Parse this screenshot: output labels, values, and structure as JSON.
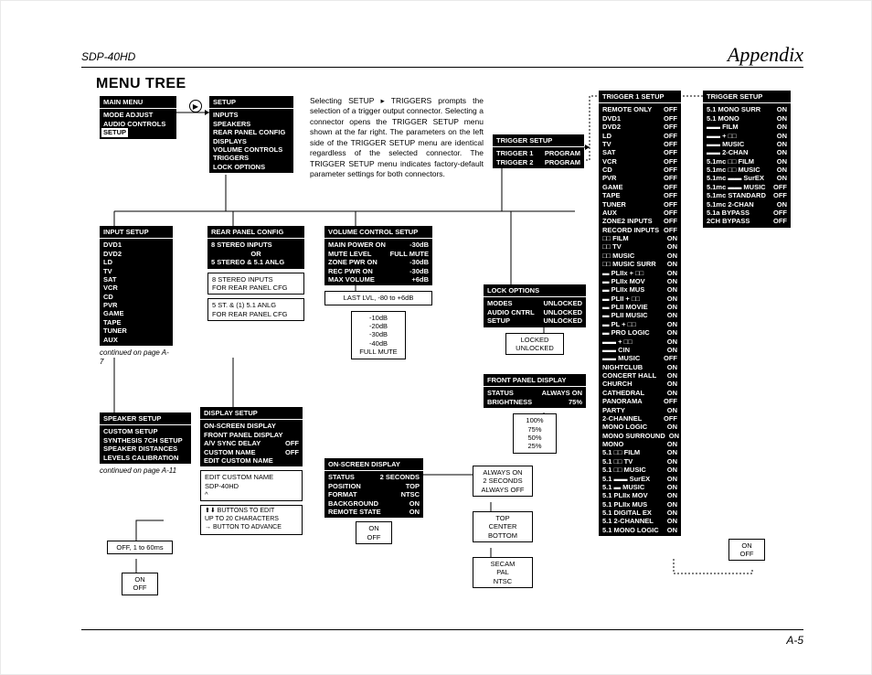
{
  "header": {
    "model": "SDP-40HD",
    "section": "Appendix",
    "page_no": "A-5"
  },
  "title": "MENU TREE",
  "body_text": "Selecting SETUP ▸ TRIGGERS prompts the selection of a trigger output connector. Selecting a connector opens the TRIGGER SETUP menu shown at the far right. The parameters on the left side of the TRIGGER SETUP menu are identical regardless of the selected connector. The TRIGGER SETUP menu indicates factory-default parameter settings for both connectors.",
  "main_menu": {
    "title": "MAIN MENU",
    "items": [
      "MODE ADJUST",
      "AUDIO CONTROLS",
      "SETUP"
    ]
  },
  "setup": {
    "title": "SETUP",
    "items": [
      "INPUTS",
      "SPEAKERS",
      "REAR PANEL CONFIG",
      "DISPLAYS",
      "VOLUME CONTROLS",
      "TRIGGERS",
      "LOCK OPTIONS"
    ]
  },
  "input_setup": {
    "title": "INPUT SETUP",
    "items": [
      "DVD1",
      "DVD2",
      "LD",
      "TV",
      "SAT",
      "VCR",
      "CD",
      "PVR",
      "GAME",
      "TAPE",
      "TUNER",
      "AUX"
    ],
    "continued": "continued on page A-7"
  },
  "speaker_setup": {
    "title": "SPEAKER SETUP",
    "items": [
      "CUSTOM SETUP",
      "SYNTHESIS 7CH SETUP",
      "SPEAKER DISTANCES",
      "LEVELS CALIBRATION"
    ],
    "continued": "continued on page A-11"
  },
  "avsync_opts": {
    "a": "OFF, 1 to 60ms",
    "b": [
      "ON",
      "OFF"
    ]
  },
  "rear_panel": {
    "title": "REAR PANEL CONFIG",
    "items": [
      "8 STEREO INPUTS",
      "OR",
      "5 STEREO & 5.1 ANLG"
    ],
    "sub1": "8 STEREO INPUTS\nFOR REAR PANEL CFG",
    "sub2": "5 ST. & (1) 5.1 ANLG\nFOR REAR PANEL CFG"
  },
  "display_setup": {
    "title": "DISPLAY SETUP",
    "rows": [
      [
        "ON-SCREEN DISPLAY",
        ""
      ],
      [
        "FRONT PANEL DISPLAY",
        ""
      ],
      [
        "A/V SYNC DELAY",
        "OFF"
      ],
      [
        "CUSTOM NAME",
        "OFF"
      ],
      [
        "EDIT CUSTOM NAME",
        ""
      ]
    ],
    "edit_box": "EDIT CUSTOM NAME\nSDP-40HD\n^",
    "hint": "⬆⬇ BUTTONS TO EDIT\nUP TO 20 CHARACTERS\n→ BUTTON TO ADVANCE"
  },
  "volume_control": {
    "title": "VOLUME CONTROL SETUP",
    "rows": [
      [
        "MAIN POWER ON",
        "-30dB"
      ],
      [
        "MUTE LEVEL",
        "FULL MUTE"
      ],
      [
        "ZONE PWR ON",
        "-30dB"
      ],
      [
        "REC PWR ON",
        "-30dB"
      ],
      [
        "MAX VOLUME",
        "+6dB"
      ]
    ],
    "sub1": "LAST LVL, -80 to +6dB",
    "sub2": [
      "-10dB",
      "-20dB",
      "-30dB",
      "-40dB",
      "FULL MUTE"
    ]
  },
  "osd": {
    "title": "ON-SCREEN DISPLAY",
    "rows": [
      [
        "STATUS",
        "2 SECONDS"
      ],
      [
        "POSITION",
        "TOP"
      ],
      [
        "FORMAT",
        "NTSC"
      ],
      [
        "BACKGROUND",
        "ON"
      ],
      [
        "REMOTE STATE",
        "ON"
      ]
    ],
    "onoff": [
      "ON",
      "OFF"
    ]
  },
  "osd_opts": {
    "status": [
      "ALWAYS ON",
      "2 SECONDS",
      "ALWAYS OFF"
    ],
    "position": [
      "TOP",
      "CENTER",
      "BOTTOM"
    ],
    "format": [
      "SECAM",
      "PAL",
      "NTSC"
    ]
  },
  "front_panel": {
    "title": "FRONT PANEL DISPLAY",
    "rows": [
      [
        "STATUS",
        "ALWAYS ON"
      ],
      [
        "BRIGHTNESS",
        "75%"
      ]
    ],
    "opts": [
      "100%",
      "75%",
      "50%",
      "25%"
    ]
  },
  "lock": {
    "title": "LOCK OPTIONS",
    "rows": [
      [
        "MODES",
        "UNLOCKED"
      ],
      [
        "AUDIO CNTRL",
        "UNLOCKED"
      ],
      [
        "SETUP",
        "UNLOCKED"
      ]
    ],
    "opts": [
      "LOCKED",
      "UNLOCKED"
    ]
  },
  "trigger_setup": {
    "title": "TRIGGER SETUP",
    "rows": [
      [
        "TRIGGER 1",
        "PROGRAM"
      ],
      [
        "TRIGGER 2",
        "PROGRAM"
      ]
    ]
  },
  "trigger1": {
    "title": "TRIGGER 1 SETUP",
    "rows": [
      [
        "REMOTE ONLY",
        "OFF"
      ],
      [
        "DVD1",
        "OFF"
      ],
      [
        "DVD2",
        "OFF"
      ],
      [
        "LD",
        "OFF"
      ],
      [
        "TV",
        "OFF"
      ],
      [
        "SAT",
        "OFF"
      ],
      [
        "VCR",
        "OFF"
      ],
      [
        "CD",
        "OFF"
      ],
      [
        "PVR",
        "OFF"
      ],
      [
        "GAME",
        "OFF"
      ],
      [
        "TAPE",
        "OFF"
      ],
      [
        "TUNER",
        "OFF"
      ],
      [
        "AUX",
        "OFF"
      ],
      [
        "ZONE2 INPUTS",
        "OFF"
      ],
      [
        "RECORD INPUTS",
        "OFF"
      ],
      [
        "□□ FILM",
        "ON"
      ],
      [
        "□□ TV",
        "ON"
      ],
      [
        "□□ MUSIC",
        "ON"
      ],
      [
        "□□ MUSIC SURR",
        "ON"
      ],
      [
        "▬ PLIIx + □□",
        "ON"
      ],
      [
        "▬ PLIIx MOV",
        "ON"
      ],
      [
        "▬ PLIIx MUS",
        "ON"
      ],
      [
        "▬ PLII + □□",
        "ON"
      ],
      [
        "▬ PLII MOVIE",
        "ON"
      ],
      [
        "▬ PLII MUSIC",
        "ON"
      ],
      [
        "▬ PL + □□",
        "ON"
      ],
      [
        "▬ PRO LOGIC",
        "ON"
      ],
      [
        "▬▬ + □□",
        "ON"
      ],
      [
        "▬▬ CIN",
        "ON"
      ],
      [
        "▬▬ MUSIC",
        "OFF"
      ],
      [
        "NIGHTCLUB",
        "ON"
      ],
      [
        "CONCERT HALL",
        "ON"
      ],
      [
        "CHURCH",
        "ON"
      ],
      [
        "CATHEDRAL",
        "ON"
      ],
      [
        "PANORAMA",
        "OFF"
      ],
      [
        "PARTY",
        "ON"
      ],
      [
        "2-CHANNEL",
        "OFF"
      ],
      [
        "MONO LOGIC",
        "ON"
      ],
      [
        "MONO SURROUND",
        "ON"
      ],
      [
        "MONO",
        "ON"
      ],
      [
        "5.1 □□ FILM",
        "ON"
      ],
      [
        "5.1 □□ TV",
        "ON"
      ],
      [
        "5.1 □□ MUSIC",
        "ON"
      ],
      [
        "5.1 ▬▬ SurEX",
        "ON"
      ],
      [
        "5.1 ▬ MUSIC",
        "ON"
      ],
      [
        "5.1 PLIIx MOV",
        "ON"
      ],
      [
        "5.1 PLIIx MUS",
        "ON"
      ],
      [
        "5.1 DIGITAL EX",
        "ON"
      ],
      [
        "5.1 2-CHANNEL",
        "ON"
      ],
      [
        "5.1 MONO LOGIC",
        "ON"
      ]
    ]
  },
  "trigger_default": {
    "title": "TRIGGER SETUP",
    "rows": [
      [
        "5.1 MONO SURR",
        "ON"
      ],
      [
        "5.1 MONO",
        "ON"
      ],
      [
        "▬▬ FILM",
        "ON"
      ],
      [
        "▬▬ + □□",
        "ON"
      ],
      [
        "▬▬ MUSIC",
        "ON"
      ],
      [
        "▬▬ 2-CHAN",
        "ON"
      ],
      [
        "5.1mc □□ FILM",
        "ON"
      ],
      [
        "5.1mc □□ MUSIC",
        "ON"
      ],
      [
        "5.1mc ▬▬ SurEX",
        "ON"
      ],
      [
        "5.1mc ▬▬ MUSIC",
        "OFF"
      ],
      [
        "5.1mc STANDARD",
        "OFF"
      ],
      [
        "5.1mc 2-CHAN",
        "ON"
      ],
      [
        "5.1a BYPASS",
        "OFF"
      ],
      [
        "2CH BYPASS",
        "OFF"
      ]
    ],
    "onoff": [
      "ON",
      "OFF"
    ]
  }
}
